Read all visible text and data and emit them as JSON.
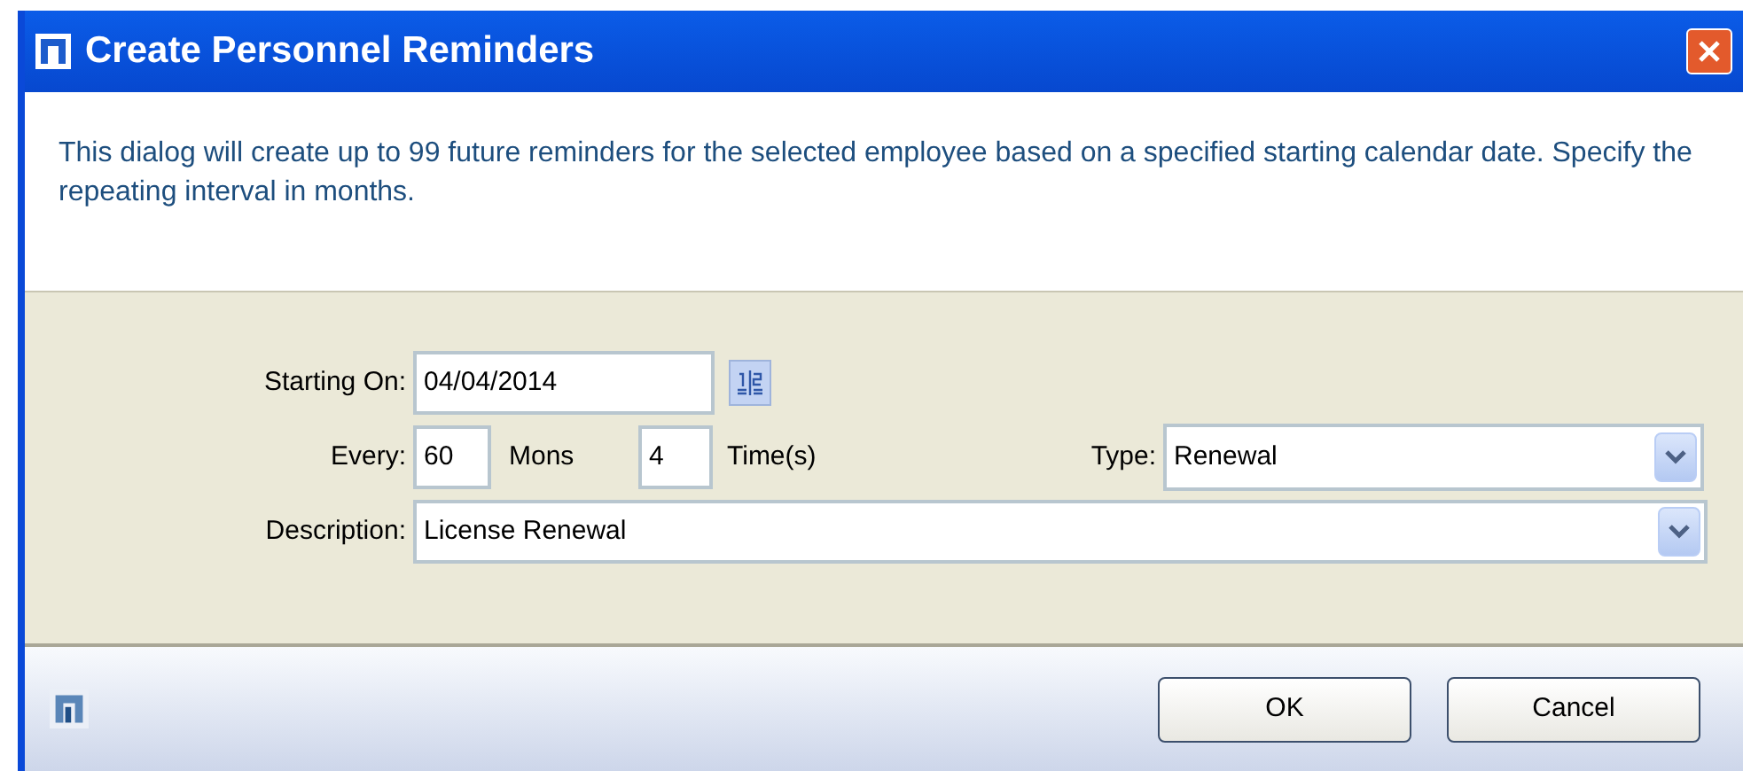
{
  "window": {
    "title": "Create Personnel Reminders"
  },
  "intro": "This dialog will create up to 99 future reminders for the selected employee based on a specified starting calendar date. Specify the repeating interval in months.",
  "form": {
    "starting_on": {
      "label": "Starting On:",
      "value": "04/04/2014"
    },
    "every": {
      "label": "Every:",
      "value": "60",
      "unit": "Mons",
      "times_value": "4",
      "times_unit": "Time(s)"
    },
    "type": {
      "label": "Type:",
      "value": "Renewal"
    },
    "description": {
      "label": "Description:",
      "value": "License Renewal"
    }
  },
  "buttons": [
    {
      "label": "OK"
    },
    {
      "label": "Cancel"
    }
  ]
}
